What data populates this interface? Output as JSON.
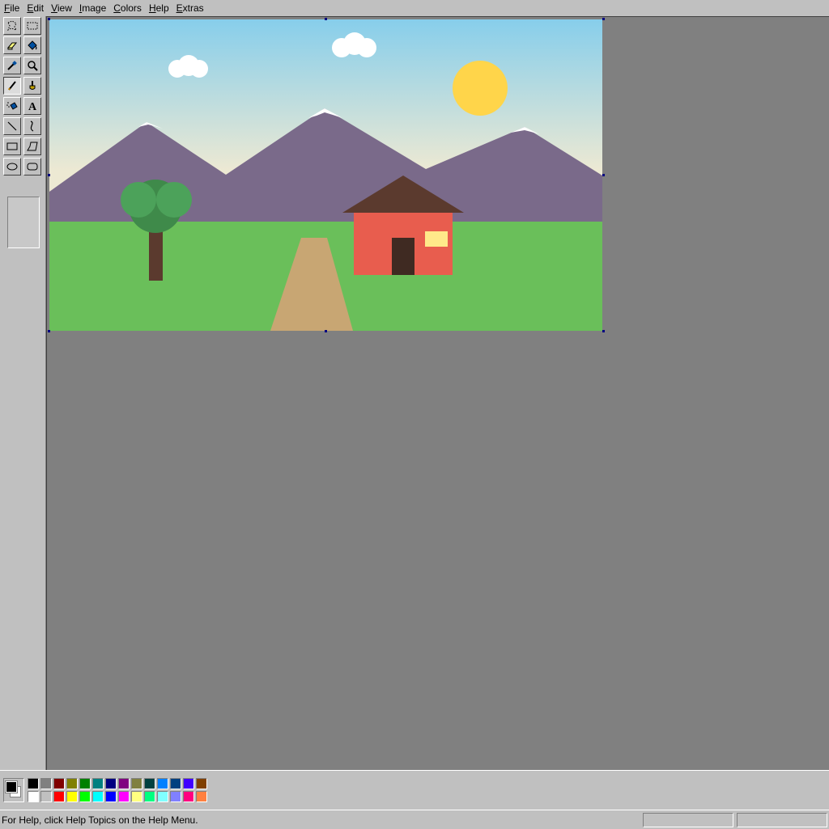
{
  "menu": {
    "items": [
      {
        "accel": "F",
        "rest": "ile"
      },
      {
        "accel": "E",
        "rest": "dit"
      },
      {
        "accel": "V",
        "rest": "iew"
      },
      {
        "accel": "I",
        "rest": "mage"
      },
      {
        "accel": "C",
        "rest": "olors"
      },
      {
        "accel": "H",
        "rest": "elp"
      },
      {
        "accel": "E",
        "rest": "xtras"
      }
    ]
  },
  "toolbox": {
    "tools": [
      {
        "name": "free-form-select",
        "icon": "free-form-select-icon"
      },
      {
        "name": "rect-select",
        "icon": "rect-select-icon"
      },
      {
        "name": "eraser",
        "icon": "eraser-icon"
      },
      {
        "name": "fill",
        "icon": "fill-bucket-icon"
      },
      {
        "name": "pick-color",
        "icon": "eyedropper-icon"
      },
      {
        "name": "magnifier",
        "icon": "magnifier-icon"
      },
      {
        "name": "pencil",
        "icon": "pencil-icon",
        "selected": true
      },
      {
        "name": "brush",
        "icon": "brush-icon"
      },
      {
        "name": "airbrush",
        "icon": "airbrush-icon"
      },
      {
        "name": "text",
        "icon": "text-icon",
        "glyph": "A"
      },
      {
        "name": "line",
        "icon": "line-icon"
      },
      {
        "name": "curve",
        "icon": "curve-icon"
      },
      {
        "name": "rectangle",
        "icon": "rectangle-icon"
      },
      {
        "name": "polygon",
        "icon": "polygon-icon"
      },
      {
        "name": "ellipse",
        "icon": "ellipse-icon"
      },
      {
        "name": "rounded-rectangle",
        "icon": "rounded-rectangle-icon"
      }
    ]
  },
  "colors": {
    "foreground": "#000000",
    "background": "#ffffff",
    "palette_top": [
      "#000000",
      "#808080",
      "#800000",
      "#808000",
      "#008000",
      "#008080",
      "#000080",
      "#800080",
      "#808040",
      "#004040",
      "#0080ff",
      "#004080",
      "#4000ff",
      "#804000"
    ],
    "palette_bottom": [
      "#ffffff",
      "#c0c0c0",
      "#ff0000",
      "#ffff00",
      "#00ff00",
      "#00ffff",
      "#0000ff",
      "#ff00ff",
      "#ffff80",
      "#00ff80",
      "#80ffff",
      "#8080ff",
      "#ff0080",
      "#ff8040"
    ]
  },
  "status": {
    "help_text": "For Help, click Help Topics on the Help Menu."
  }
}
